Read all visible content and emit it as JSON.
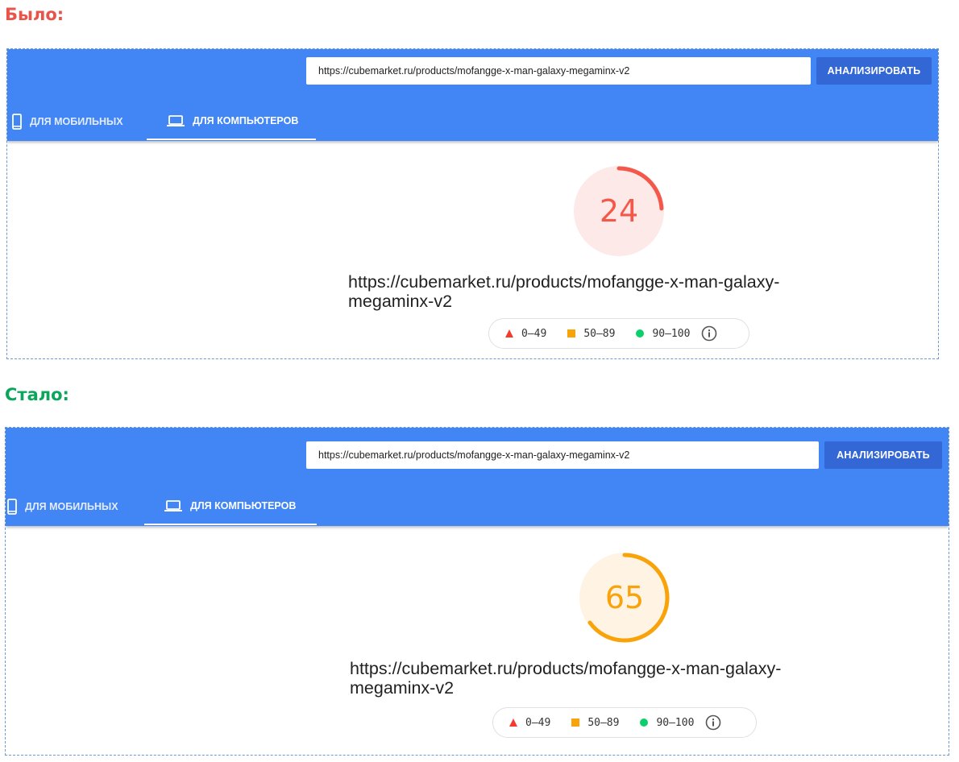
{
  "before": {
    "heading": "Было:",
    "url_input_value": "https://cubemarket.ru/products/mofangge-x-man-galaxy-megaminx-v2",
    "analyze_label": "АНАЛИЗИРОВАТЬ",
    "tab_mobile": "ДЛЯ МОБИЛЬНЫХ",
    "tab_desktop": "ДЛЯ КОМПЬЮТЕРОВ",
    "score": "24",
    "score_value": 24,
    "score_color": "#f4584a",
    "score_bg": "#fde9e7",
    "tested_url": "https://cubemarket.ru/products/mofangge-x-man-galaxy-megaminx-v2",
    "legend": {
      "low": "0–49",
      "mid": "50–89",
      "high": "90–100"
    }
  },
  "after": {
    "heading": "Стало:",
    "url_input_value": "https://cubemarket.ru/products/mofangge-x-man-galaxy-megaminx-v2",
    "analyze_label": "АНАЛИЗИРОВАТЬ",
    "tab_mobile": "ДЛЯ МОБИЛЬНЫХ",
    "tab_desktop": "ДЛЯ КОМПЬЮТЕРОВ",
    "score": "65",
    "score_value": 65,
    "score_color": "#f9a30a",
    "score_bg": "#fff4e3",
    "tested_url": "https://cubemarket.ru/products/mofangge-x-man-galaxy-megaminx-v2",
    "legend": {
      "low": "0–49",
      "mid": "50–89",
      "high": "90–100"
    }
  },
  "colors": {
    "heading_before": "#e8534a",
    "heading_after": "#0ba55b",
    "bar": "#4285f4",
    "button": "#3367d6",
    "legend_red": "#f33b2f",
    "legend_orange": "#f9a30a",
    "legend_green": "#0cce6b"
  },
  "icons": {
    "mobile": "smartphone-icon",
    "desktop": "laptop-icon",
    "info": "info-icon"
  }
}
